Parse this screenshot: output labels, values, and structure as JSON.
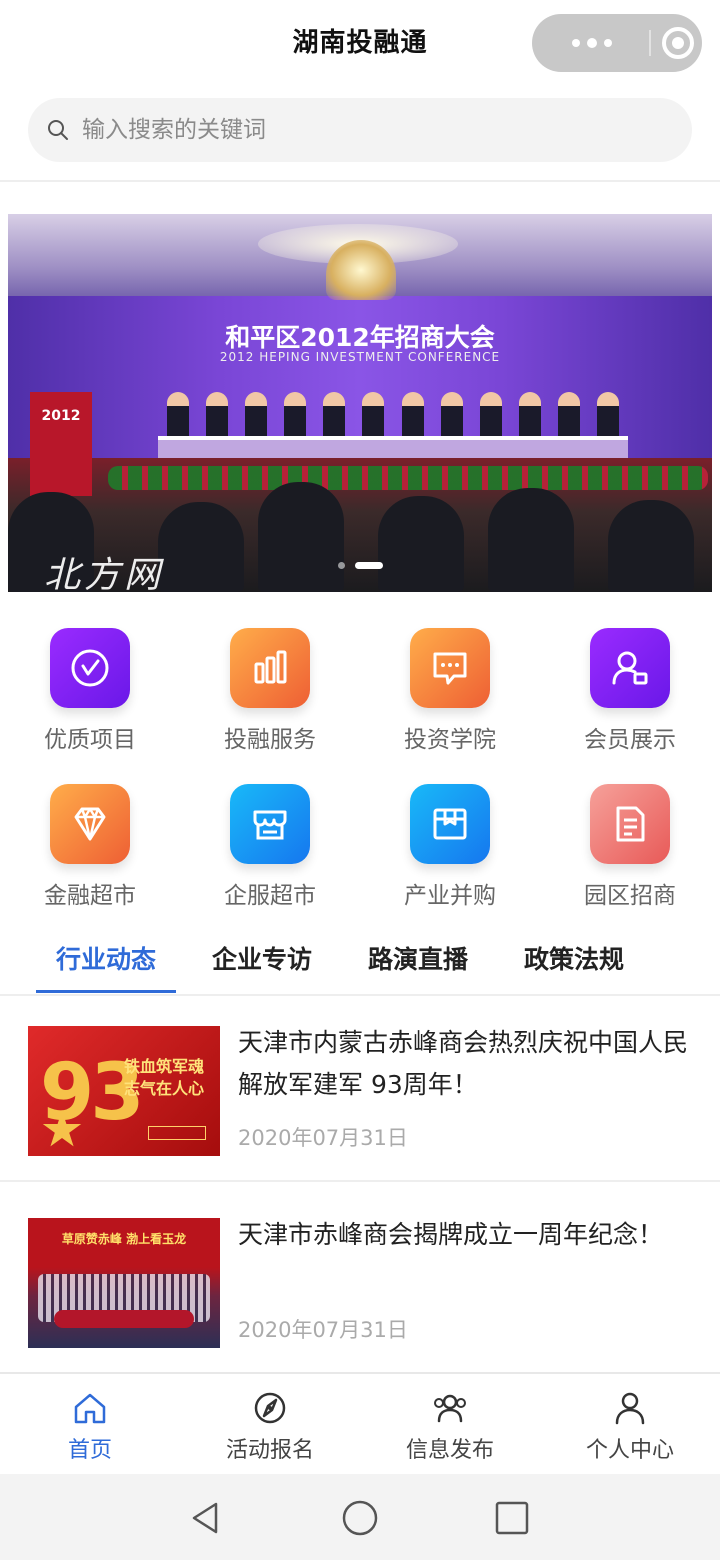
{
  "app": {
    "title": "湖南投融通"
  },
  "search": {
    "placeholder": "输入搜索的关键词"
  },
  "banner": {
    "stage_title": "和平区2012年招商大会",
    "stage_subtitle": "2012 HEPING INVESTMENT CONFERENCE",
    "podium_text": "2012",
    "watermark": "北方网",
    "slide_count": 2,
    "active_slide": 2
  },
  "grid": {
    "items": [
      {
        "label": "优质项目",
        "icon": "clock-check-icon",
        "color": "purple"
      },
      {
        "label": "投融服务",
        "icon": "bar-chart-icon",
        "color": "orange"
      },
      {
        "label": "投资学院",
        "icon": "chat-bubble-icon",
        "color": "orange"
      },
      {
        "label": "会员展示",
        "icon": "user-card-icon",
        "color": "purple"
      },
      {
        "label": "金融超市",
        "icon": "diamond-icon",
        "color": "orange"
      },
      {
        "label": "企服超市",
        "icon": "storefront-icon",
        "color": "blue"
      },
      {
        "label": "产业并购",
        "icon": "package-icon",
        "color": "blue"
      },
      {
        "label": "园区招商",
        "icon": "document-icon",
        "color": "pink"
      }
    ]
  },
  "tabs": {
    "items": [
      "行业动态",
      "企业专访",
      "路演直播",
      "政策法规"
    ],
    "active": "行业动态",
    "accent_color": "#2f6bd8"
  },
  "news": [
    {
      "headline": "天津市内蒙古赤峰商会热烈庆祝中国人民解放军建军 93周年！",
      "date": "2020年07月31日",
      "thumb_number": "93",
      "thumb_slogan_1": "铁血筑军魂",
      "thumb_slogan_2": "志气在人心"
    },
    {
      "headline": "天津市赤峰商会揭牌成立一周年纪念！",
      "date": "2020年07月31日",
      "thumb_band": "草原赞赤峰  渤上看玉龙"
    }
  ],
  "bottom_nav": {
    "items": [
      {
        "label": "首页",
        "icon": "home-icon"
      },
      {
        "label": "活动报名",
        "icon": "compass-icon"
      },
      {
        "label": "信息发布",
        "icon": "people-icon"
      },
      {
        "label": "个人中心",
        "icon": "person-icon"
      }
    ],
    "active": "首页"
  },
  "system_nav": {
    "items": [
      "back-icon",
      "home-circle-icon",
      "recents-icon"
    ]
  }
}
